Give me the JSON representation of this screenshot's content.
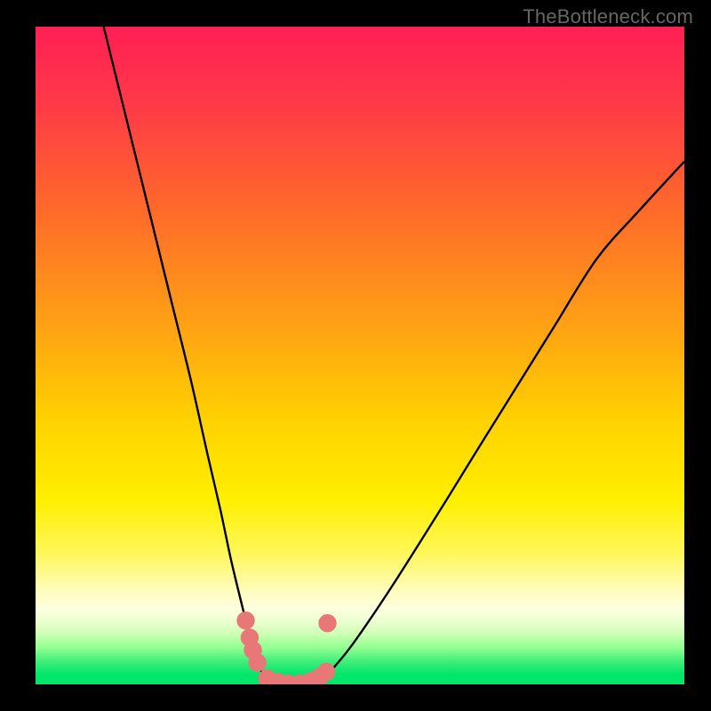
{
  "watermark": "TheBottleneck.com",
  "colors": {
    "frame": "#000000",
    "curve": "#000000",
    "dots": "#e77877",
    "greenBand": "#00e66b",
    "gradientStops": [
      {
        "offset": 0.0,
        "color": "#ff1f55"
      },
      {
        "offset": 0.12,
        "color": "#ff3a47"
      },
      {
        "offset": 0.28,
        "color": "#ff6a2a"
      },
      {
        "offset": 0.45,
        "color": "#ffa015"
      },
      {
        "offset": 0.6,
        "color": "#ffd200"
      },
      {
        "offset": 0.72,
        "color": "#ffef00"
      },
      {
        "offset": 0.8,
        "color": "#fff75a"
      },
      {
        "offset": 0.85,
        "color": "#fffbb0"
      },
      {
        "offset": 0.885,
        "color": "#fdffdf"
      },
      {
        "offset": 0.905,
        "color": "#edffd0"
      },
      {
        "offset": 0.925,
        "color": "#c8ffb0"
      },
      {
        "offset": 0.945,
        "color": "#90ff90"
      },
      {
        "offset": 0.965,
        "color": "#40ee7a"
      },
      {
        "offset": 0.985,
        "color": "#00e66b"
      },
      {
        "offset": 1.0,
        "color": "#00e66b"
      }
    ]
  },
  "chart_data": {
    "type": "line",
    "title": "",
    "xlabel": "",
    "ylabel": "",
    "xlim": [
      0,
      100
    ],
    "ylim": [
      0,
      100
    ],
    "series": [
      {
        "name": "left-branch",
        "x": [
          10.5,
          14.0,
          17.5,
          21.0,
          24.0,
          26.5,
          28.5,
          30.0,
          31.2,
          32.2,
          33.0,
          33.7,
          34.3,
          35.0,
          35.8
        ],
        "y": [
          100.0,
          86.0,
          72.0,
          58.0,
          46.0,
          35.0,
          26.5,
          19.5,
          14.5,
          10.5,
          7.3,
          4.8,
          3.0,
          1.6,
          0.6
        ]
      },
      {
        "name": "valley",
        "x": [
          35.8,
          37.0,
          38.5,
          40.0,
          41.5,
          43.0,
          44.2
        ],
        "y": [
          0.6,
          0.15,
          0.0,
          0.0,
          0.05,
          0.3,
          0.9
        ]
      },
      {
        "name": "right-branch",
        "x": [
          44.2,
          46.0,
          48.5,
          51.5,
          55.0,
          59.0,
          63.5,
          68.5,
          74.0,
          80.0,
          86.5,
          93.0,
          100.0
        ],
        "y": [
          0.9,
          2.6,
          5.6,
          9.8,
          15.0,
          21.2,
          28.3,
          36.3,
          45.0,
          54.5,
          64.7,
          72.0,
          79.5
        ]
      }
    ],
    "dots": {
      "name": "highlighted-points",
      "color": "#e77877",
      "points": [
        {
          "x": 32.4,
          "y": 9.7
        },
        {
          "x": 33.0,
          "y": 7.1
        },
        {
          "x": 33.5,
          "y": 5.2
        },
        {
          "x": 34.2,
          "y": 3.3
        },
        {
          "x": 35.7,
          "y": 0.9
        },
        {
          "x": 37.4,
          "y": 0.35
        },
        {
          "x": 39.0,
          "y": 0.1
        },
        {
          "x": 40.8,
          "y": 0.15
        },
        {
          "x": 42.5,
          "y": 0.5
        },
        {
          "x": 43.8,
          "y": 1.1
        },
        {
          "x": 44.8,
          "y": 1.9
        },
        {
          "x": 45.0,
          "y": 9.3
        }
      ]
    }
  }
}
